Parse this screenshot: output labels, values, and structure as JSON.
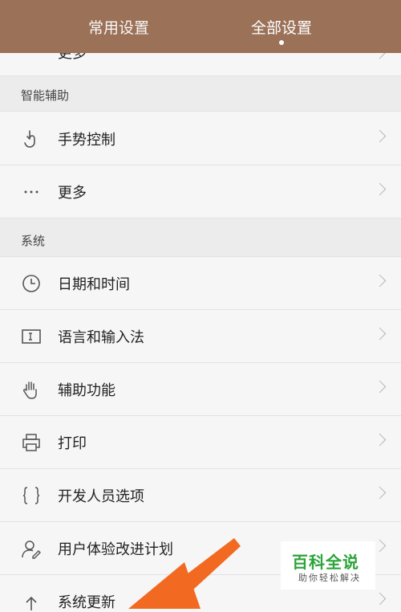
{
  "header": {
    "tabs": [
      {
        "label": "常用设置",
        "active": false
      },
      {
        "label": "全部设置",
        "active": true
      }
    ]
  },
  "partial_row": {
    "label": "更多"
  },
  "sections": [
    {
      "title": "智能辅助",
      "items": [
        {
          "label": "手势控制",
          "icon": "gesture-hand-icon"
        },
        {
          "label": "更多",
          "icon": "more-dots-icon"
        }
      ]
    },
    {
      "title": "系统",
      "items": [
        {
          "label": "日期和时间",
          "icon": "clock-icon"
        },
        {
          "label": "语言和输入法",
          "icon": "keyboard-icon"
        },
        {
          "label": "辅助功能",
          "icon": "hand-icon"
        },
        {
          "label": "打印",
          "icon": "printer-icon"
        },
        {
          "label": "开发人员选项",
          "icon": "braces-icon"
        },
        {
          "label": "用户体验改进计划",
          "icon": "user-edit-icon"
        },
        {
          "label": "系统更新",
          "icon": "upload-arrow-icon"
        }
      ]
    }
  ],
  "watermark": {
    "title": "百科全说",
    "subtitle": "助你轻松解决"
  },
  "colors": {
    "header_bg": "#9b7158",
    "arrow": "#f26a21",
    "watermark_green": "#2ba43a"
  }
}
